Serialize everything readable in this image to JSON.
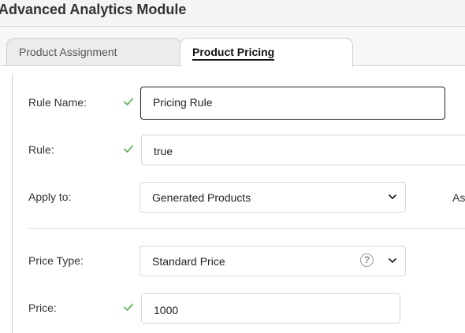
{
  "window": {
    "title": "Advanced Analytics Module"
  },
  "tabs": [
    {
      "label": "Product Assignment",
      "active": false
    },
    {
      "label": "Product Pricing",
      "active": true
    }
  ],
  "form": {
    "rule_name": {
      "label": "Rule Name:",
      "value": "Pricing Rule",
      "valid": true
    },
    "rule": {
      "label": "Rule:",
      "value": "true",
      "valid": true
    },
    "apply_to": {
      "label": "Apply to:",
      "value": "Generated Products"
    },
    "apply_side_label": "As",
    "price_type": {
      "label": "Price Type:",
      "value": "Standard Price",
      "help_icon": "question-mark-icon",
      "help_glyph": "?"
    },
    "price": {
      "label": "Price:",
      "value": "1000",
      "valid": true
    }
  },
  "colors": {
    "check": "#5cb85c",
    "active_border": "#222222"
  }
}
